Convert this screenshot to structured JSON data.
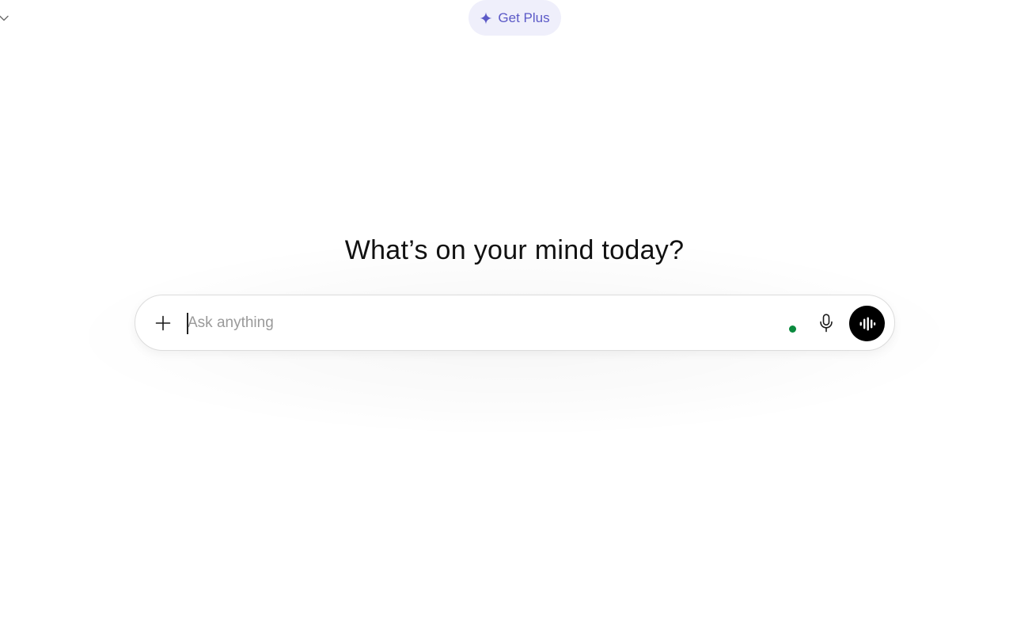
{
  "header": {
    "model_menu_icon": "chevron-down-icon",
    "upgrade_label": "Get Plus",
    "upgrade_icon": "sparkle-icon",
    "upgrade_color": "#5b59c7",
    "upgrade_background": "#efeffb"
  },
  "main": {
    "headline": "What’s on your mind today?"
  },
  "composer": {
    "placeholder": "Ask anything",
    "value": "",
    "attach_icon": "plus-icon",
    "status_color": "#0a8a3e",
    "dictate_icon": "microphone-icon",
    "voice_mode_icon": "waveform-icon"
  }
}
